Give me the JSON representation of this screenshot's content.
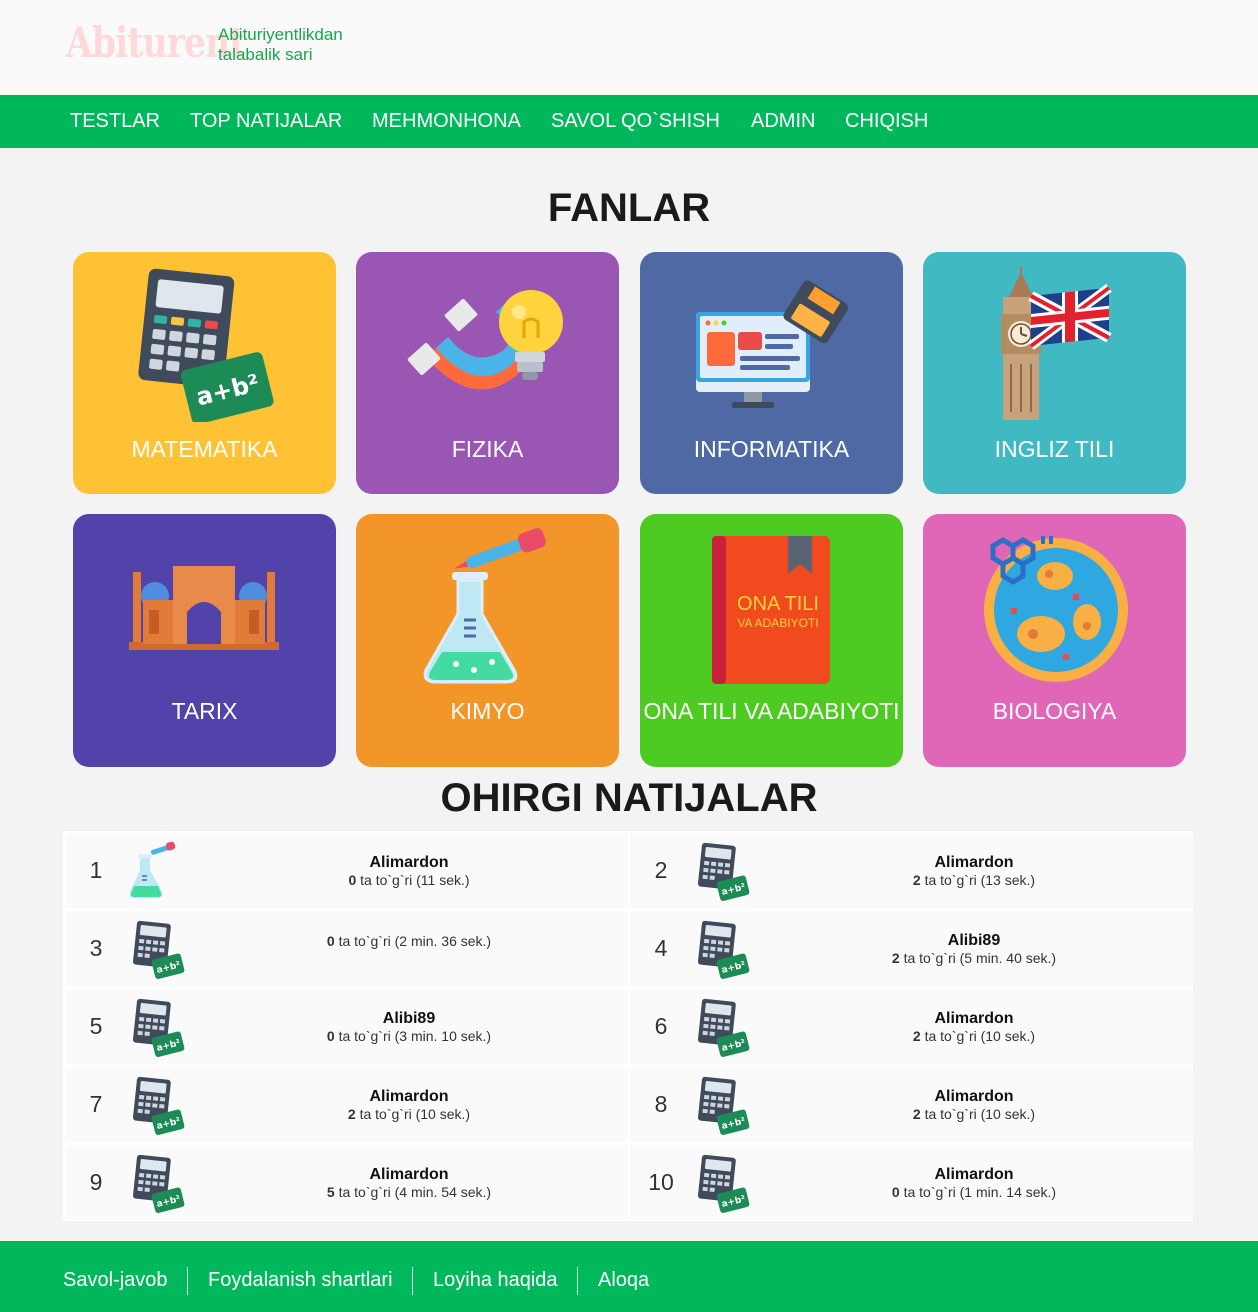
{
  "header": {
    "logo_text": "Abiturent",
    "tagline": "Abituriyentlikdan talabalik sari"
  },
  "nav": [
    {
      "label": "TESTLAR"
    },
    {
      "label": "TOP NATIJALAR"
    },
    {
      "label": "MEHMONHONA"
    },
    {
      "label": "SAVOL QO`SHISH"
    },
    {
      "label": "ADMIN"
    },
    {
      "label": "CHIQISH"
    }
  ],
  "subjects_title": "FANLAR",
  "subjects": [
    {
      "label": "MATEMATIKA",
      "color": "#fec234",
      "icon": "calculator-icon"
    },
    {
      "label": "FIZIKA",
      "color": "#9a56b3",
      "icon": "magnet-bulb-icon"
    },
    {
      "label": "INFORMATIKA",
      "color": "#4e69a4",
      "icon": "computer-icon"
    },
    {
      "label": "INGLIZ TILI",
      "color": "#41b9c2",
      "icon": "big-ben-flag-icon"
    },
    {
      "label": "TARIX",
      "color": "#5243aa",
      "icon": "registan-icon"
    },
    {
      "label": "KIMYO",
      "color": "#f3962a",
      "icon": "flask-icon"
    },
    {
      "label": "ONA TILI VA ADABIYOTI",
      "color": "#4ecb22",
      "icon": "book-icon",
      "book_title": "ONA TILI",
      "book_subtitle": "VA ADABIYOTI"
    },
    {
      "label": "BIOLOGIYA",
      "color": "#e066b7",
      "icon": "petri-dish-icon"
    }
  ],
  "results_title": "OHIRGI NATIJALAR",
  "results": [
    {
      "rank": "1",
      "icon": "flask-icon",
      "name": "Alimardon",
      "correct": "0",
      "suffix": " ta to`g`ri (11 sek.)"
    },
    {
      "rank": "2",
      "icon": "calculator-icon",
      "name": "Alimardon",
      "correct": "2",
      "suffix": " ta to`g`ri (13 sek.)"
    },
    {
      "rank": "3",
      "icon": "calculator-icon",
      "name": "",
      "correct": "0",
      "suffix": " ta to`g`ri (2 min. 36 sek.)"
    },
    {
      "rank": "4",
      "icon": "calculator-icon",
      "name": "Alibi89",
      "correct": "2",
      "suffix": " ta to`g`ri (5 min. 40 sek.)"
    },
    {
      "rank": "5",
      "icon": "calculator-icon",
      "name": "Alibi89",
      "correct": "0",
      "suffix": " ta to`g`ri (3 min. 10 sek.)"
    },
    {
      "rank": "6",
      "icon": "calculator-icon",
      "name": "Alimardon",
      "correct": "2",
      "suffix": " ta to`g`ri (10 sek.)"
    },
    {
      "rank": "7",
      "icon": "calculator-icon",
      "name": "Alimardon",
      "correct": "2",
      "suffix": " ta to`g`ri (10 sek.)"
    },
    {
      "rank": "8",
      "icon": "calculator-icon",
      "name": "Alimardon",
      "correct": "2",
      "suffix": " ta to`g`ri (10 sek.)"
    },
    {
      "rank": "9",
      "icon": "calculator-icon",
      "name": "Alimardon",
      "correct": "5",
      "suffix": " ta to`g`ri (4 min. 54 sek.)"
    },
    {
      "rank": "10",
      "icon": "calculator-icon",
      "name": "Alimardon",
      "correct": "0",
      "suffix": " ta to`g`ri (1 min. 14 sek.)"
    }
  ],
  "footer": [
    {
      "label": "Savol-javob"
    },
    {
      "label": "Foydalanish shartlari"
    },
    {
      "label": "Loyiha haqida"
    },
    {
      "label": "Aloqa"
    }
  ]
}
